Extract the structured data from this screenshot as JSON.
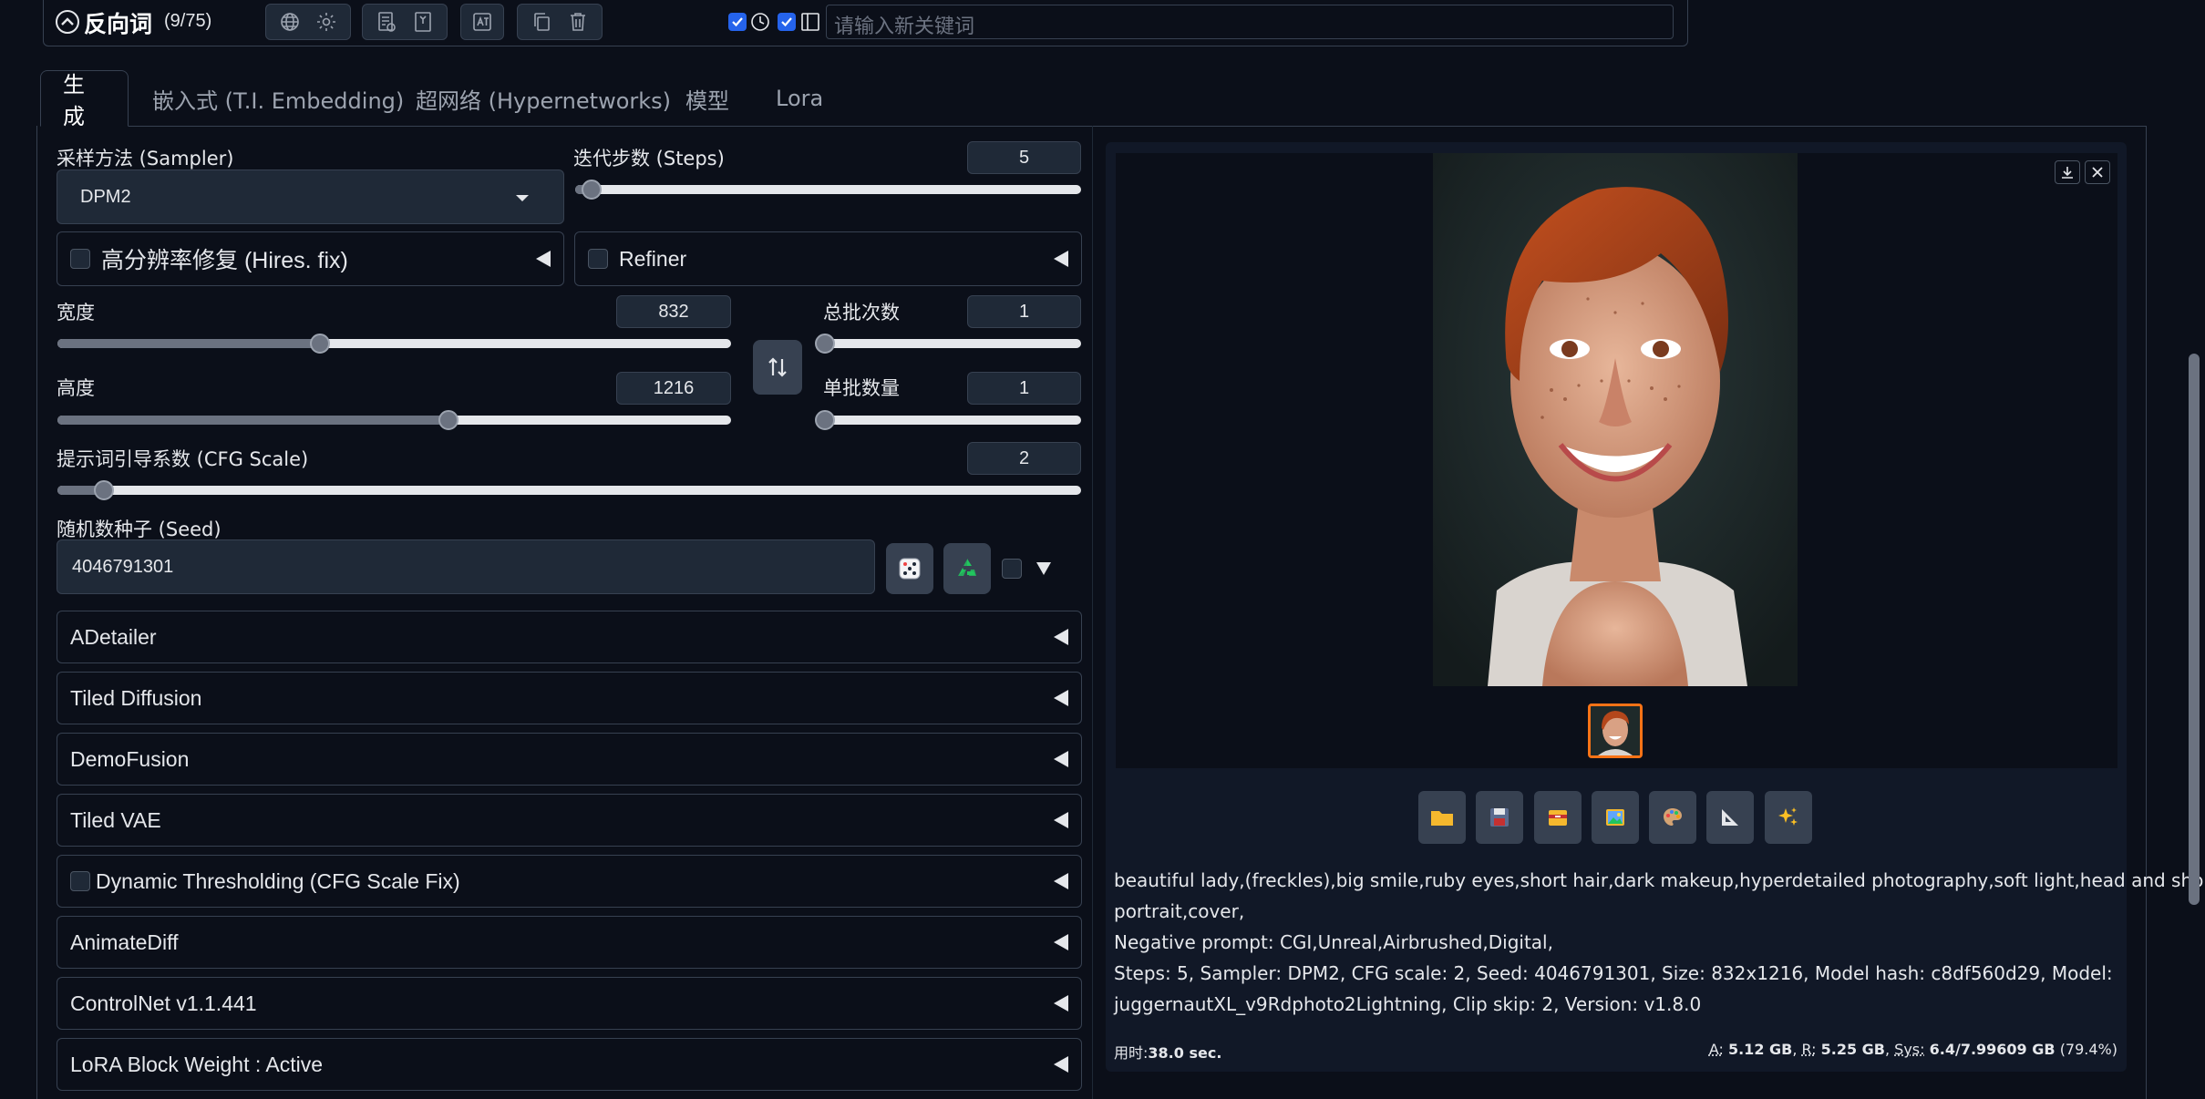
{
  "negative_prompt": {
    "title": "反向词",
    "count": "(9/75)",
    "keyword_placeholder": "请输入新关键词"
  },
  "tabs": [
    {
      "label": "生成",
      "active": true
    },
    {
      "label": "嵌入式 (T.I. Embedding)"
    },
    {
      "label": "超网络 (Hypernetworks)"
    },
    {
      "label": "模型"
    },
    {
      "label": "Lora"
    }
  ],
  "sampler": {
    "label": "采样方法 (Sampler)",
    "value": "DPM2"
  },
  "steps": {
    "label": "迭代步数 (Steps)",
    "value": "5",
    "level": 0.033
  },
  "hires": {
    "label": "高分辨率修复 (Hires. fix)"
  },
  "refiner": {
    "label": "Refiner"
  },
  "width": {
    "label": "宽度",
    "value": "832",
    "level": 0.39
  },
  "height": {
    "label": "高度",
    "value": "1216",
    "level": 0.58
  },
  "batch_count": {
    "label": "总批次数",
    "value": "1",
    "level": 0
  },
  "batch_size": {
    "label": "单批数量",
    "value": "1",
    "level": 0
  },
  "cfg": {
    "label": "提示词引导系数 (CFG Scale)",
    "value": "2",
    "level": 0.045
  },
  "seed": {
    "label": "随机数种子 (Seed)",
    "value": "4046791301"
  },
  "accordions": [
    {
      "label": "ADetailer",
      "checkbox": false
    },
    {
      "label": "Tiled Diffusion",
      "checkbox": false
    },
    {
      "label": "DemoFusion",
      "checkbox": false
    },
    {
      "label": "Tiled VAE",
      "checkbox": false
    },
    {
      "label": "Dynamic Thresholding (CFG Scale Fix)",
      "checkbox": true
    },
    {
      "label": "AnimateDiff",
      "checkbox": false
    },
    {
      "label": "ControlNet v1.1.441",
      "checkbox": false
    },
    {
      "label": "LoRA Block Weight : Active",
      "checkbox": false
    }
  ],
  "output": {
    "prompt_line1": "beautiful lady,(freckles),big smile,ruby eyes,short hair,dark makeup,hyperdetailed photography,soft light,head and shoulders",
    "prompt_line2": "portrait,cover,",
    "negative_line": "Negative prompt: CGI,Unreal,Airbrushed,Digital,",
    "params_line1": "Steps: 5, Sampler: DPM2, CFG scale: 2, Seed: 4046791301, Size: 832x1216, Model hash: c8df560d29, Model:",
    "params_line2": "juggernautXL_v9Rdphoto2Lightning, Clip skip: 2, Version: v1.8.0",
    "time_label": "用时:",
    "time_value": "38.0 sec.",
    "mem_a_label": "A:",
    "mem_a": "5.12 GB",
    "mem_r_label": "R:",
    "mem_r": "5.25 GB",
    "mem_sys_label": "Sys:",
    "mem_sys": "6.4/7.99609 GB",
    "mem_pct": "(79.4%)"
  }
}
